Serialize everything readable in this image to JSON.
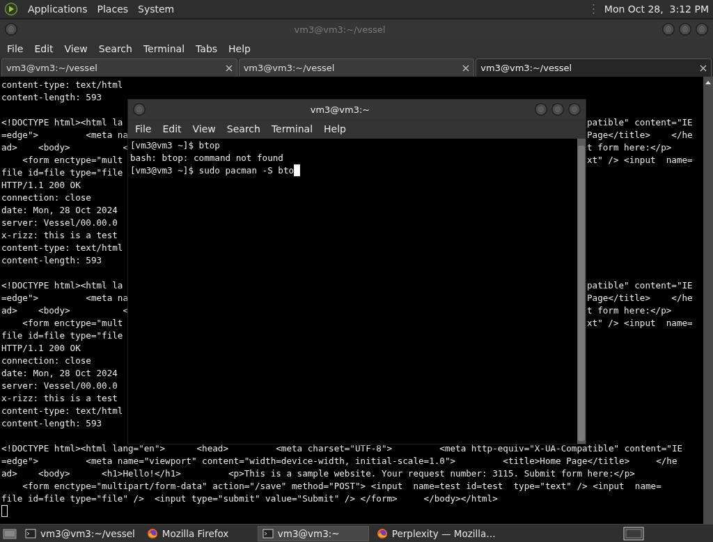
{
  "top_panel": {
    "menus": [
      "Applications",
      "Places",
      "System"
    ],
    "clock": "Mon Oct 28,  3:12 PM"
  },
  "window": {
    "title": "vm3@vm3:~/vessel",
    "menus": [
      "File",
      "Edit",
      "View",
      "Search",
      "Terminal",
      "Tabs",
      "Help"
    ],
    "tabs": [
      {
        "label": "vm3@vm3:~/vessel",
        "selected": false
      },
      {
        "label": "vm3@vm3:~/vessel",
        "selected": false
      },
      {
        "label": "vm3@vm3:~/vessel",
        "selected": true
      }
    ],
    "blocks": [
      [
        {
          "left": "content-type: text/html"
        },
        {
          "left": "content-length: 593"
        }
      ],
      [
        {
          "left": "<!DOCTYPE html><html la",
          "right": "patible\" content=\"IE"
        },
        {
          "left": "=edge\">         <meta na",
          "right": "Page</title>    </he"
        },
        {
          "left": "ad>    <body>          <",
          "right": "t form here:</p>"
        },
        {
          "left": "    <form enctype=\"mult",
          "right": "xt\" /> <input  name="
        },
        {
          "left": "file id=file type=\"file"
        },
        {
          "left": "HTTP/1.1 200 OK"
        },
        {
          "left": "connection: close"
        },
        {
          "left": "date: Mon, 28 Oct 2024"
        },
        {
          "left": "server: Vessel/00.00.0"
        },
        {
          "left": "x-rizz: this is a test"
        },
        {
          "left": "content-type: text/html"
        },
        {
          "left": "content-length: 593"
        }
      ],
      [
        {
          "left": "<!DOCTYPE html><html la",
          "right": "patible\" content=\"IE"
        },
        {
          "left": "=edge\">         <meta na",
          "right": "Page</title>    </he"
        },
        {
          "left": "ad>    <body>          <",
          "right": "t form here:</p>"
        },
        {
          "left": "    <form enctype=\"mult",
          "right": "xt\" /> <input  name="
        },
        {
          "left": "file id=file type=\"file"
        },
        {
          "left": "HTTP/1.1 200 OK"
        },
        {
          "left": "connection: close"
        },
        {
          "left": "date: Mon, 28 Oct 2024"
        },
        {
          "left": "server: Vessel/00.00.0"
        },
        {
          "left": "x-rizz: this is a test"
        },
        {
          "left": "content-type: text/html"
        },
        {
          "left": "content-length: 593"
        }
      ],
      [
        {
          "left": "<!DOCTYPE html><html lang=\"en\">      <head>         <meta charset=\"UTF-8\">         <meta http-equiv=\"X-UA-Compatible\" content=\"IE"
        },
        {
          "left": "=edge\">         <meta name=\"viewport\" content=\"width=device-width, initial-scale=1.0\">         <title>Home Page</title>     </he"
        },
        {
          "left": "ad>    <body>      <h1>Hello!</h1>         <p>This is a sample website. Your request number: 3115. Submit form here:</p>"
        },
        {
          "left": "    <form enctype=\"multipart/form-data\" action=\"/save\" method=\"POST\"> <input  name=test id=test  type=\"text\" /> <input  name="
        },
        {
          "left": "file id=file type=\"file\" />  <input type=\"submit\" value=\"Submit\" /> </form>     </body></html>"
        }
      ]
    ],
    "cursor": true
  },
  "dialog": {
    "title": "vm3@vm3:~",
    "menus": [
      "File",
      "Edit",
      "View",
      "Search",
      "Terminal",
      "Help"
    ],
    "lines": [
      "[vm3@vm3 ~]$ btop",
      "bash: btop: command not found",
      "[vm3@vm3 ~]$ sudo pacman -S bto"
    ],
    "cursor": true
  },
  "taskbar": {
    "items": [
      {
        "label": "vm3@vm3:~/vessel",
        "kind": "terminal",
        "selected": false
      },
      {
        "label": "Mozilla Firefox",
        "kind": "browser",
        "selected": false
      },
      {
        "label": "vm3@vm3:~",
        "kind": "terminal",
        "selected": true
      },
      {
        "label": "Perplexity — Mozilla…",
        "kind": "browser",
        "selected": false
      }
    ]
  }
}
